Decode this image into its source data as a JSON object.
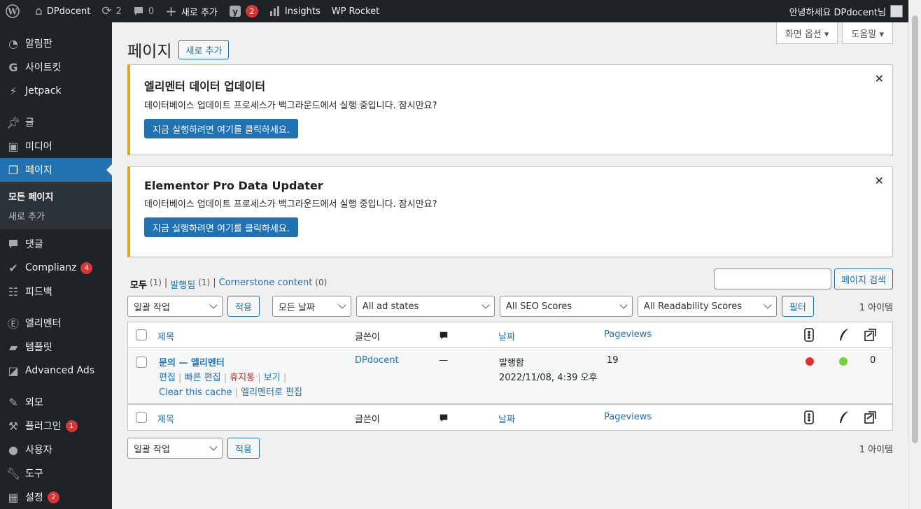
{
  "adminbar": {
    "site_name": "DPdocent",
    "updates_count": "2",
    "comments_count": "0",
    "new_label": "새로 추가",
    "yoast_badge": "2",
    "insights_label": "Insights",
    "wp_rocket_label": "WP Rocket",
    "greeting": "안녕하세요 DPdocent님"
  },
  "sidebar": {
    "items": [
      {
        "label": "알림판",
        "icon": "dashboard-icon"
      },
      {
        "label": "사이트킷",
        "icon": "site-kit-icon"
      },
      {
        "label": "Jetpack",
        "icon": "jetpack-icon"
      },
      {
        "label": "글",
        "icon": "pin-icon"
      },
      {
        "label": "미디어",
        "icon": "media-icon"
      },
      {
        "label": "페이지",
        "icon": "page-icon"
      },
      {
        "label": "댓글",
        "icon": "comment-icon"
      },
      {
        "label": "Complianz",
        "icon": "check-icon",
        "badge": "4"
      },
      {
        "label": "피드백",
        "icon": "feedback-icon"
      },
      {
        "label": "엘리멘터",
        "icon": "elementor-icon"
      },
      {
        "label": "템플릿",
        "icon": "folder-icon"
      },
      {
        "label": "Advanced Ads",
        "icon": "ads-icon"
      },
      {
        "label": "외모",
        "icon": "brush-icon"
      },
      {
        "label": "플러그인",
        "icon": "plugin-icon",
        "badge": "1"
      },
      {
        "label": "사용자",
        "icon": "user-icon"
      },
      {
        "label": "도구",
        "icon": "wrench-icon"
      },
      {
        "label": "설정",
        "icon": "settings-icon",
        "badge": "2"
      }
    ],
    "submenu": [
      "모든 페이지",
      "새로 추가"
    ]
  },
  "screen_meta": {
    "options": "화면 옵션 ▾",
    "help": "도움말 ▾"
  },
  "page": {
    "title": "페이지",
    "add_new": "새로 추가"
  },
  "notices": [
    {
      "title": "엘리멘터 데이터 업데이터",
      "text": "데이터베이스 업데이트 프로세스가 백그라운드에서 실행 중입니다. 잠시만요?",
      "button": "지금 실행하려면 여기를 클릭하세요."
    },
    {
      "title": "Elementor Pro Data Updater",
      "text": "데이터베이스 업데이트 프로세스가 백그라운드에서 실행 중입니다. 잠시만요?",
      "button": "지금 실행하려면 여기를 클릭하세요."
    }
  ],
  "views": {
    "all": "모두",
    "all_count": "(1)",
    "published": "발행됨",
    "published_count": "(1)",
    "cornerstone": "Cornerstone content",
    "cornerstone_count": "(0)"
  },
  "search": {
    "button": "페이지 검색"
  },
  "filters": {
    "bulk": "일괄 작업",
    "apply": "적용",
    "dates": "모든 날짜",
    "ad_states": "All ad states",
    "seo": "All SEO Scores",
    "readability": "All Readability Scores",
    "filter": "필터",
    "items": "1 아이템"
  },
  "table": {
    "headers": {
      "title": "제목",
      "author": "글쓴이",
      "date": "날짜",
      "pageviews": "Pageviews"
    },
    "rows": [
      {
        "title": "문의 — 엘리멘터",
        "author": "DPdocent",
        "comments": "—",
        "status": "발행함",
        "date": "2022/11/08, 4:39 오후",
        "pageviews": "19",
        "seo_color": "#dc3232",
        "readability_color": "#7ad03a",
        "links": "0",
        "actions": {
          "edit": "편집",
          "quick_edit": "빠른 편집",
          "trash": "휴지통",
          "view": "보기",
          "clear_cache": "Clear this cache",
          "elementor_edit": "엘리멘터로 편집"
        }
      }
    ]
  }
}
